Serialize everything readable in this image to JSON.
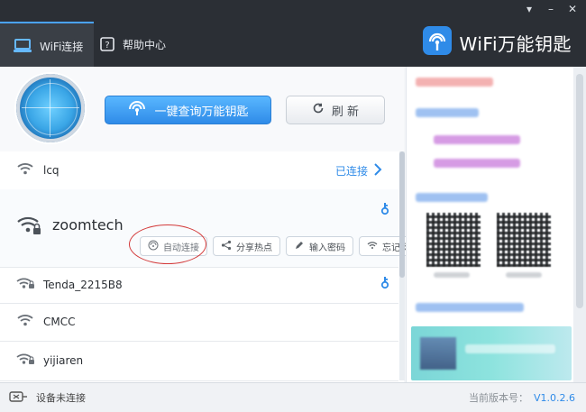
{
  "window": {
    "controls": [
      "▾",
      "–",
      "✕"
    ],
    "brand_title": "WiFi万能钥匙"
  },
  "tabs": [
    {
      "label": "WiFi连接",
      "icon": "laptop-icon",
      "active": true
    },
    {
      "label": "帮助中心",
      "icon": "help-icon",
      "active": false
    }
  ],
  "hero": {
    "primary_button": "一键查询万能钥匙",
    "refresh_button": "刷 新"
  },
  "networks": [
    {
      "name": "lcq",
      "status": "已连接"
    },
    {
      "name": "zoomtech",
      "actions": [
        "自动连接",
        "分享热点",
        "输入密码",
        "忘记网络"
      ]
    },
    {
      "name": "Tenda_2215B8"
    },
    {
      "name": "CMCC"
    },
    {
      "name": "yijiaren"
    }
  ],
  "status_bar": {
    "device_status": "设备未连接",
    "version_label": "当前版本号：",
    "version": "V1.0.2.6"
  },
  "colors": {
    "accent": "#2f8be8",
    "topbar": "#2b2f35",
    "annotation_red": "#d33a3a"
  }
}
